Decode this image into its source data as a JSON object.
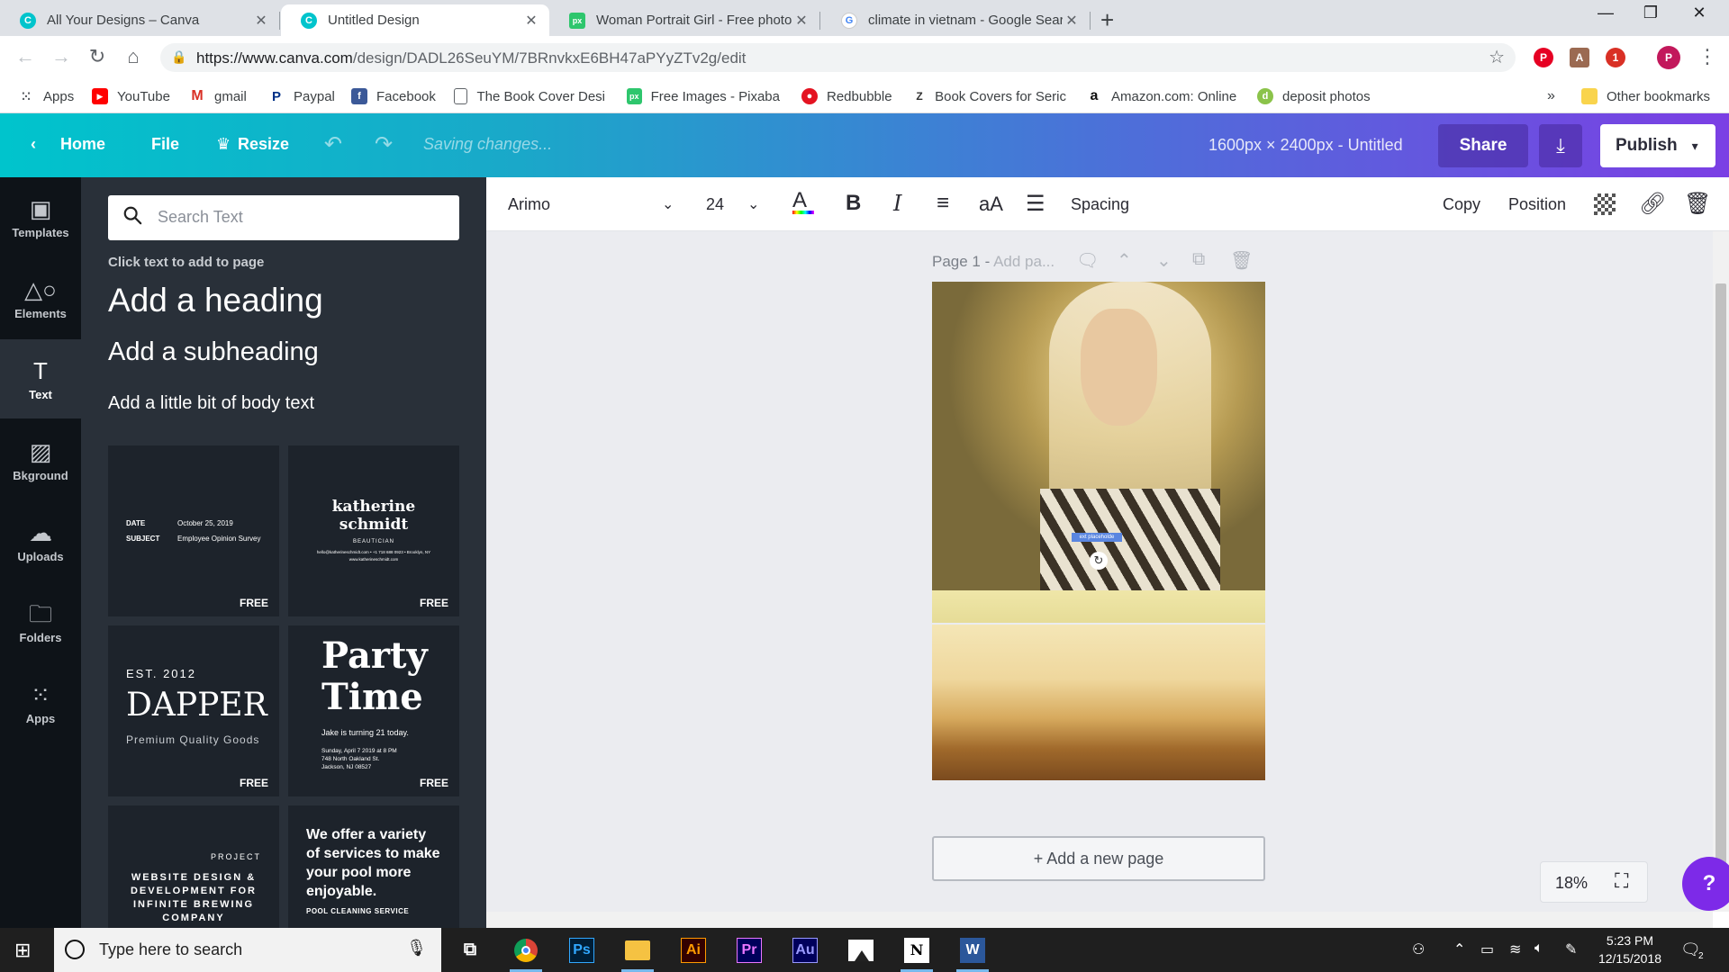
{
  "browser": {
    "tabs": [
      {
        "title": "All Your Designs – Canva",
        "favicon": "canva-icon",
        "color": "#00c4cc"
      },
      {
        "title": "Untitled Design",
        "favicon": "canva-icon",
        "color": "#00c4cc"
      },
      {
        "title": "Woman Portrait Girl - Free photo",
        "favicon": "pixabay-icon",
        "color": "#2ec66d"
      },
      {
        "title": "climate in vietnam - Google Sear",
        "favicon": "google-icon",
        "color": "#4285f4"
      }
    ],
    "url_host": "https://www.canva.com",
    "url_path": "/design/DADL26SeuYM/7BRnvkxE6BH47aPYyZTv2g/edit",
    "bookmarks": [
      {
        "label": "Apps"
      },
      {
        "label": "YouTube"
      },
      {
        "label": "gmail"
      },
      {
        "label": "Paypal"
      },
      {
        "label": "Facebook"
      },
      {
        "label": "The Book Cover Desi"
      },
      {
        "label": "Free Images - Pixaba"
      },
      {
        "label": "Redbubble"
      },
      {
        "label": "Book Covers for Seric"
      },
      {
        "label": "Amazon.com: Online"
      },
      {
        "label": "deposit photos"
      }
    ],
    "more_bookmarks": "»",
    "other_bookmarks": "Other bookmarks",
    "profile_initial": "P",
    "ext_badge": "1"
  },
  "header": {
    "home": "Home",
    "file": "File",
    "resize": "Resize",
    "status": "Saving changes...",
    "dims": "1600px × 2400px - Untitled",
    "share": "Share",
    "publish": "Publish"
  },
  "rail": {
    "items": [
      {
        "label": "Templates"
      },
      {
        "label": "Elements"
      },
      {
        "label": "Text"
      },
      {
        "label": "Bkground"
      },
      {
        "label": "Uploads"
      },
      {
        "label": "Folders"
      },
      {
        "label": "Apps"
      }
    ]
  },
  "panel": {
    "search_placeholder": "Search Text",
    "hint": "Click text to add to page",
    "add_heading": "Add a heading",
    "add_subheading": "Add a subheading",
    "add_body": "Add a little bit of body text",
    "free": "FREE",
    "tpl1": {
      "date_k": "DATE",
      "date_v": "October 25, 2019",
      "subj_k": "SUBJECT",
      "subj_v": "Employee Opinion Survey"
    },
    "tpl2": {
      "name1": "katherine",
      "name2": "schmidt",
      "role": "BEAUTICIAN",
      "line1": "hello@katherineschmidt.com • +1 718 688 0923 • Brooklyn, NY",
      "line2": "www.katherineschmidt.com"
    },
    "tpl3": {
      "est": "EST. 2012",
      "brand": "DAPPER",
      "tagline": "Premium Quality Goods"
    },
    "tpl4": {
      "t1": "Party",
      "t2": "Time",
      "sub": "Jake is turning 21 today.",
      "d1": "Sunday, April 7 2019 at 8 PM",
      "d2": "748 North Oakland St.",
      "d3": "Jackson, NJ 08527"
    },
    "tpl5": {
      "project": "PROJECT",
      "l1": "WEBSITE DESIGN &",
      "l2": "DEVELOPMENT FOR",
      "l3": "INFINITE BREWING",
      "l4": "COMPANY"
    },
    "tpl6": {
      "l1": "We offer a variety",
      "l2": "of services to make",
      "l3": "your pool more",
      "l4": "enjoyable.",
      "foot": "POOL CLEANING SERVICE"
    }
  },
  "format_toolbar": {
    "font": "Arimo",
    "size": "24",
    "spacing": "Spacing",
    "copy": "Copy",
    "position": "Position",
    "case": "aA"
  },
  "canvas": {
    "page_label": "Page 1 - ",
    "page_add": "Add pa...",
    "placeholder": "ext placeholde",
    "add_page": "+ Add a new page",
    "zoom": "18%",
    "help": "?"
  },
  "taskbar": {
    "search": "Type here to search",
    "apps": [
      {
        "label": "Ps",
        "color": "#31a8ff",
        "bg": "#001e36"
      },
      {
        "label": "Ai",
        "color": "#ff9a00",
        "bg": "#330000"
      },
      {
        "label": "Pr",
        "color": "#ea77ff",
        "bg": "#00005b"
      },
      {
        "label": "Au",
        "color": "#9999ff",
        "bg": "#00005b"
      },
      {
        "label": "N",
        "color": "#000000",
        "bg": "#ffffff"
      },
      {
        "label": "W",
        "color": "#ffffff",
        "bg": "#2b579a"
      }
    ],
    "time": "5:23 PM",
    "date": "12/15/2018",
    "notif_count": "2"
  }
}
